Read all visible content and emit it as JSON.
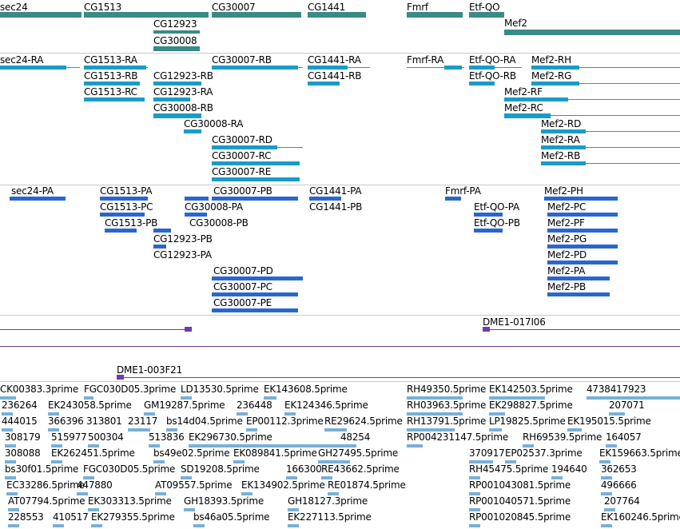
{
  "colors": {
    "gene": "#3a8a85",
    "transcript": "#1a9cc4",
    "protein": "#2a66cf",
    "est_line": "#6a40a8",
    "read": "#78b0d8",
    "separator": "#c8c8c8"
  },
  "track_genes": {
    "items": [
      {
        "label": "sec24"
      },
      {
        "label": "CG1513"
      },
      {
        "label": "CG12923"
      },
      {
        "label": "CG30008"
      },
      {
        "label": "CG30007"
      },
      {
        "label": "CG1441"
      },
      {
        "label": "Fmrf"
      },
      {
        "label": "Etf-QO"
      },
      {
        "label": "Mef2"
      }
    ]
  },
  "track_transcripts": {
    "items": [
      {
        "label": "sec24-RA"
      },
      {
        "label": "CG1513-RA"
      },
      {
        "label": "CG1513-RB"
      },
      {
        "label": "CG1513-RC"
      },
      {
        "label": "CG12923-RB"
      },
      {
        "label": "CG12923-RA"
      },
      {
        "label": "CG30008-RB"
      },
      {
        "label": "CG30008-RA"
      },
      {
        "label": "CG30007-RB"
      },
      {
        "label": "CG30007-RD"
      },
      {
        "label": "CG30007-RC"
      },
      {
        "label": "CG30007-RE"
      },
      {
        "label": "CG1441-RA"
      },
      {
        "label": "CG1441-RB"
      },
      {
        "label": "Fmrf-RA"
      },
      {
        "label": "Etf-QO-RA"
      },
      {
        "label": "Etf-QO-RB"
      },
      {
        "label": "Mef2-RH"
      },
      {
        "label": "Mef2-RG"
      },
      {
        "label": "Mef2-RF"
      },
      {
        "label": "Mef2-RC"
      },
      {
        "label": "Mef2-RD"
      },
      {
        "label": "Mef2-RA"
      },
      {
        "label": "Mef2-RB"
      }
    ]
  },
  "track_proteins": {
    "items": [
      {
        "label": "sec24-PA"
      },
      {
        "label": "CG1513-PA"
      },
      {
        "label": "CG1513-PC"
      },
      {
        "label": "CG1513-PB"
      },
      {
        "label": "CG30008-PA"
      },
      {
        "label": "CG30008-PB"
      },
      {
        "label": "CG12923-PB"
      },
      {
        "label": "CG12923-PA"
      },
      {
        "label": "CG30007-PB"
      },
      {
        "label": "CG30007-PD"
      },
      {
        "label": "CG30007-PC"
      },
      {
        "label": "CG30007-PE"
      },
      {
        "label": "CG1441-PA"
      },
      {
        "label": "CG1441-PB"
      },
      {
        "label": "Fmrf-PA"
      },
      {
        "label": "Etf-QO-PA"
      },
      {
        "label": "Etf-QO-PB"
      },
      {
        "label": "Mef2-PH"
      },
      {
        "label": "Mef2-PC"
      },
      {
        "label": "Mef2-PF"
      },
      {
        "label": "Mef2-PG"
      },
      {
        "label": "Mef2-PD"
      },
      {
        "label": "Mef2-PA"
      },
      {
        "label": "Mef2-PB"
      }
    ]
  },
  "track_cdna": {
    "items": [
      {
        "label": "DME1-017I06"
      },
      {
        "label": "DME1-003F21"
      }
    ]
  },
  "track_ests": {
    "items": [
      {
        "label": "CK00383.3prime"
      },
      {
        "label": "FGC030D05.3prime"
      },
      {
        "label": "LD13530.5prime"
      },
      {
        "label": "EK143608.5prime"
      },
      {
        "label": "RH49350.5prime"
      },
      {
        "label": "EK142503.5prime"
      },
      {
        "label": "4738417923"
      },
      {
        "label": "236264"
      },
      {
        "label": "EK243058.5prime"
      },
      {
        "label": "GM19287.5prime"
      },
      {
        "label": "236448"
      },
      {
        "label": "EK124346.5prime"
      },
      {
        "label": "RH03963.5prime"
      },
      {
        "label": "EK298827.5prime"
      },
      {
        "label": "207071"
      },
      {
        "label": "444015"
      },
      {
        "label": "366396"
      },
      {
        "label": "313801"
      },
      {
        "label": "23117"
      },
      {
        "label": "bs14d04.5prime"
      },
      {
        "label": "EP00112.3prime"
      },
      {
        "label": "RE29624.5prime"
      },
      {
        "label": "RH13791.5prime"
      },
      {
        "label": "LP19825.5prime"
      },
      {
        "label": "EK195015.5prime"
      },
      {
        "label": "308179"
      },
      {
        "label": "515977"
      },
      {
        "label": "500304"
      },
      {
        "label": "513836"
      },
      {
        "label": "EK296730.5prime"
      },
      {
        "label": "48254"
      },
      {
        "label": "RP004231147.5prime"
      },
      {
        "label": "RH69539.5prime"
      },
      {
        "label": "164057"
      },
      {
        "label": "308088"
      },
      {
        "label": "EK262451.5prime"
      },
      {
        "label": "bs49e02.5prime"
      },
      {
        "label": "EK089841.5prime"
      },
      {
        "label": "GH27495.5prime"
      },
      {
        "label": "370917"
      },
      {
        "label": "EP02537.3prime"
      },
      {
        "label": "EK159663.5prime"
      },
      {
        "label": "bs30f01.5prime"
      },
      {
        "label": "FGC030D05.5prime"
      },
      {
        "label": "SD19208.5prime"
      },
      {
        "label": "166300"
      },
      {
        "label": "RE43662.5prime"
      },
      {
        "label": "RH45475.5prime"
      },
      {
        "label": "194640"
      },
      {
        "label": "362653"
      },
      {
        "label": "EC33286.5prime"
      },
      {
        "label": "447880"
      },
      {
        "label": "AT09557.5prime"
      },
      {
        "label": "EK134902.5prime"
      },
      {
        "label": "RE01874.5prime"
      },
      {
        "label": "RP001043081.5prime"
      },
      {
        "label": "496666"
      },
      {
        "label": "AT07794.5prime"
      },
      {
        "label": "EK303313.5prime"
      },
      {
        "label": "GH18393.5prime"
      },
      {
        "label": "GH18127.3prime"
      },
      {
        "label": "RP001040571.5prime"
      },
      {
        "label": "207764"
      },
      {
        "label": "228553"
      },
      {
        "label": "410517"
      },
      {
        "label": "EK279355.5prime"
      },
      {
        "label": "bs46a05.5prime"
      },
      {
        "label": "EK227113.5prime"
      },
      {
        "label": "RP001020845.5prime"
      },
      {
        "label": "EK160246.5prime"
      }
    ]
  }
}
